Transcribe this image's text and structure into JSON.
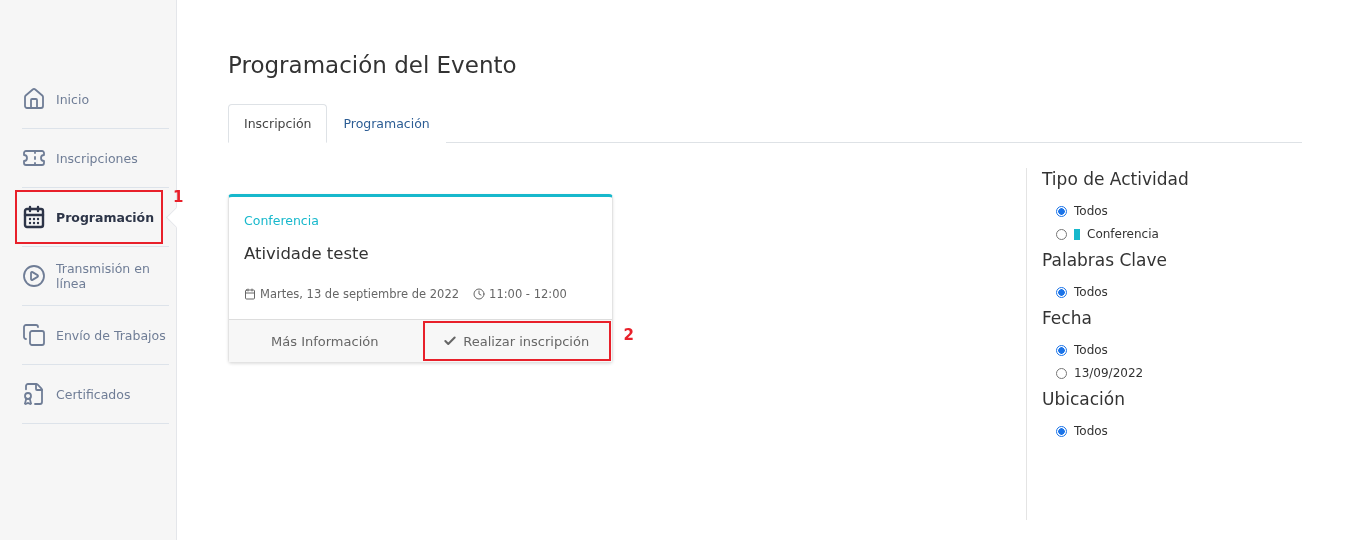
{
  "sidebar": {
    "items": [
      {
        "kind": "home",
        "label": "Inicio",
        "selected": false
      },
      {
        "kind": "ticket",
        "label": "Inscripciones",
        "selected": false
      },
      {
        "kind": "calendar",
        "label": "Programación",
        "selected": true,
        "annotation": "1"
      },
      {
        "kind": "play",
        "label": "Transmisión en línea",
        "selected": false
      },
      {
        "kind": "copy",
        "label": "Envío de Trabajos",
        "selected": false
      },
      {
        "kind": "certificate",
        "label": "Certificados",
        "selected": false
      }
    ]
  },
  "page_title": "Programación del Evento",
  "tabs": [
    {
      "label": "Inscripción",
      "selected": true
    },
    {
      "label": "Programación",
      "selected": false
    }
  ],
  "activity_card": {
    "category": "Conferencia",
    "color": "#17b8cc",
    "title": "Atividade teste",
    "date": "Martes, 13 de septiembre de 2022",
    "time": "11:00 - 12:00",
    "buttons": [
      {
        "kind": "info",
        "label": "Más Información"
      },
      {
        "kind": "enroll",
        "label": "Realizar inscripción",
        "annotation": "2"
      }
    ]
  },
  "filters": [
    {
      "title": "Tipo de Actividad",
      "options": [
        {
          "label": "Todos",
          "selected": true
        },
        {
          "label": "Conferencia",
          "selected": false,
          "color": "#17b8cc"
        }
      ]
    },
    {
      "title": "Palabras Clave",
      "options": [
        {
          "label": "Todos",
          "selected": true
        }
      ]
    },
    {
      "title": "Fecha",
      "options": [
        {
          "label": "Todos",
          "selected": true
        },
        {
          "label": "13/09/2022",
          "selected": false
        }
      ]
    },
    {
      "title": "Ubicación",
      "options": [
        {
          "label": "Todos",
          "selected": true
        }
      ]
    }
  ]
}
